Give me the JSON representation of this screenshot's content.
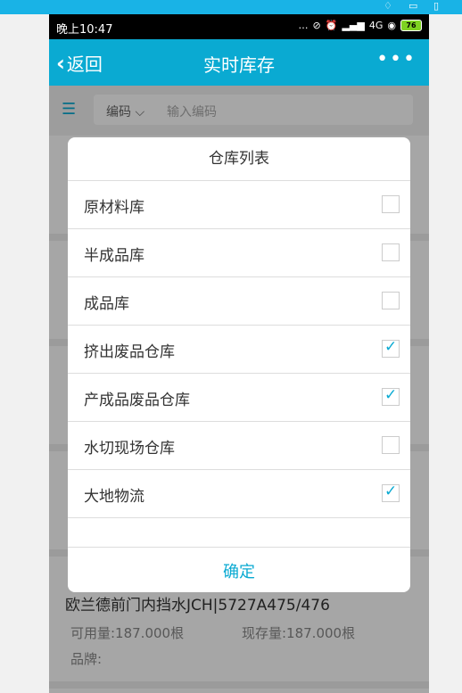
{
  "status_bar": {
    "time": "晚上10:47",
    "network": "4G",
    "battery": "76"
  },
  "nav": {
    "back_label": "返回",
    "title": "实时库存",
    "more": "•••"
  },
  "search": {
    "field_selector": "编码 ⌵",
    "placeholder": "输入编码"
  },
  "dialog": {
    "title": "仓库列表",
    "items": [
      {
        "label": "原材料库",
        "checked": false
      },
      {
        "label": "半成品库",
        "checked": false
      },
      {
        "label": "成品库",
        "checked": false
      },
      {
        "label": "挤出废品仓库",
        "checked": true
      },
      {
        "label": "产成品废品仓库",
        "checked": true
      },
      {
        "label": "水切现场仓库",
        "checked": false
      },
      {
        "label": "大地物流",
        "checked": true
      }
    ],
    "confirm_label": "确定"
  },
  "bottom_card": {
    "name": "欧兰德前门内挡水JCH|5727A475/476",
    "available": "可用量:187.000根",
    "stock": "现存量:187.000根",
    "brand": "品牌:"
  },
  "colors": {
    "accent": "#0aaad2",
    "overlay": "rgba(0,0,0,0.35)"
  }
}
